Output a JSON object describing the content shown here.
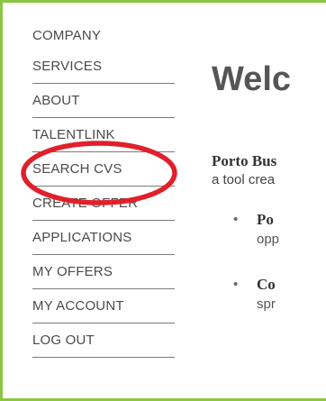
{
  "nav": {
    "items": [
      {
        "label": "COMPANY"
      },
      {
        "label": "SERVICES"
      },
      {
        "label": "ABOUT"
      },
      {
        "label": "TALENTLINK"
      },
      {
        "label": "SEARCH CVS"
      },
      {
        "label": "CREATE OFFER"
      },
      {
        "label": "APPLICATIONS"
      },
      {
        "label": "MY OFFERS"
      },
      {
        "label": "MY ACCOUNT"
      },
      {
        "label": "LOG OUT"
      }
    ]
  },
  "main": {
    "title": "Welc",
    "intro_bold": "Porto Bus",
    "intro_line2": "a tool crea",
    "bullets": [
      {
        "title": "Po",
        "sub": "opp"
      },
      {
        "title": "Co",
        "sub": "spr"
      }
    ]
  },
  "colors": {
    "frame_border": "#8cc63f",
    "annotation_circle": "#e0202a",
    "nav_text": "#4a4a4a"
  }
}
